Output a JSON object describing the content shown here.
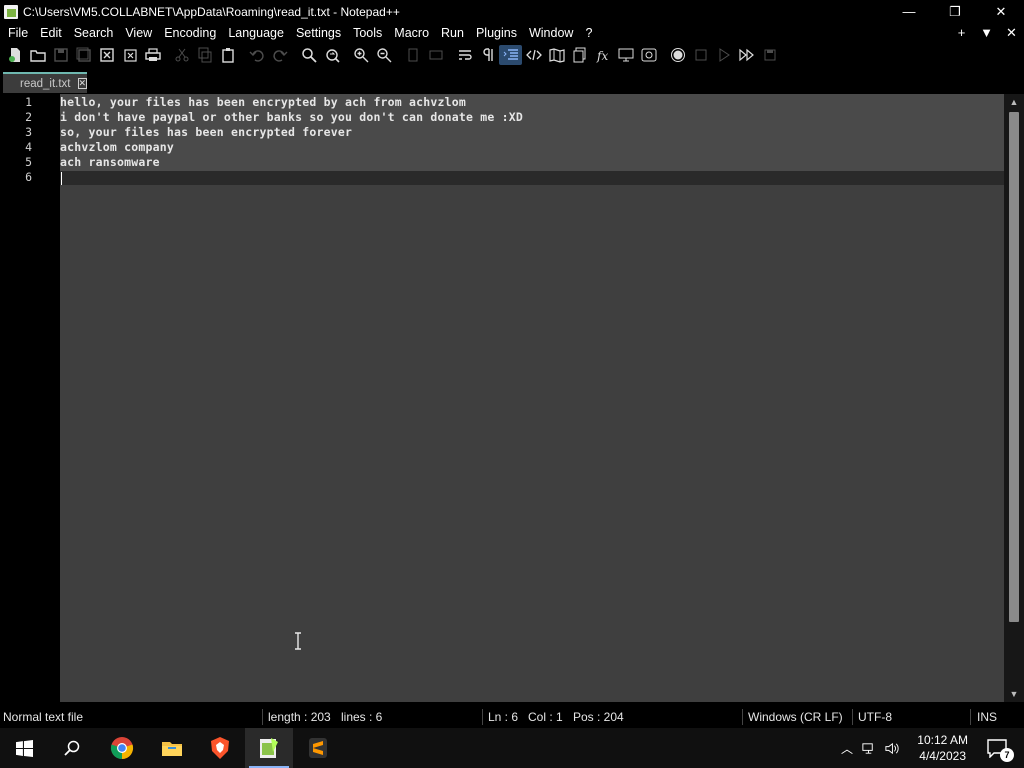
{
  "window": {
    "title": "C:\\Users\\VM5.COLLABNET\\AppData\\Roaming\\read_it.txt - Notepad++",
    "minimize": "—",
    "restore": "❐",
    "close": "✕"
  },
  "menu": {
    "items": [
      "File",
      "Edit",
      "Search",
      "View",
      "Encoding",
      "Language",
      "Settings",
      "Tools",
      "Macro",
      "Run",
      "Plugins",
      "Window",
      "?"
    ],
    "right": {
      "add": "+",
      "dropdown": "▼",
      "close": "✕"
    }
  },
  "toolbar": {
    "buttons": [
      "new-file",
      "open-file",
      "save",
      "save-all",
      "close",
      "close-all",
      "print",
      "cut",
      "copy",
      "paste",
      "undo",
      "redo",
      "find",
      "replace",
      "zoom-in",
      "zoom-out",
      "sync-vertical",
      "sync-horizontal",
      "word-wrap",
      "show-all-chars",
      "indent-guide",
      "language-tags",
      "document-map",
      "document-list",
      "function-list",
      "folder-workspace",
      "monitoring",
      "record-macro",
      "stop-record",
      "play-macro",
      "run-multiple-macro",
      "save-macro"
    ]
  },
  "tab": {
    "label": "read_it.txt",
    "close": "✕"
  },
  "editor": {
    "lines": [
      {
        "num": "1",
        "text": "hello, your files has been encrypted by ach from achvzlom"
      },
      {
        "num": "2",
        "text": "i don't have paypal or other banks so you don't can donate me :XD"
      },
      {
        "num": "3",
        "text": "so, your files has been encrypted forever"
      },
      {
        "num": "4",
        "text": "achvzlom company"
      },
      {
        "num": "5",
        "text": "ach ransomware"
      },
      {
        "num": "6",
        "text": ""
      }
    ]
  },
  "status": {
    "file_type": "Normal text file",
    "length": "length : 203",
    "lines": "lines : 6",
    "ln": "Ln : 6",
    "col": "Col : 1",
    "pos": "Pos : 204",
    "eol": "Windows (CR LF)",
    "encoding": "UTF-8",
    "mode": "INS"
  },
  "taskbar": {
    "time": "10:12 AM",
    "date": "4/4/2023",
    "notifications": "7",
    "apps": [
      "start-icon",
      "search-icon",
      "chrome-icon",
      "file-explorer-icon",
      "brave-icon",
      "notepad-plus-plus-icon",
      "sublime-icon"
    ]
  },
  "colors": {
    "editor_bg": "#3f3f3f",
    "gutter_bg": "#000000",
    "tab_accent": "#6fb8b0"
  }
}
